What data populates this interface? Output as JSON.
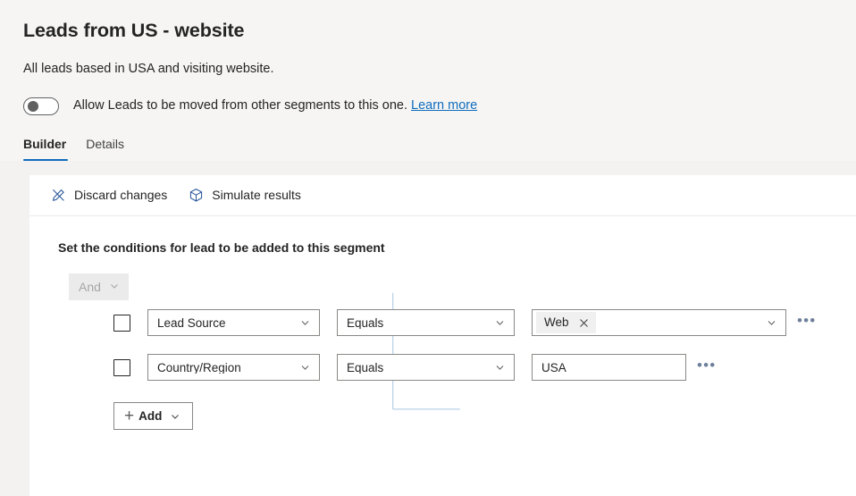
{
  "header": {
    "title": "Leads from US - website",
    "subtitle": "All leads based in USA and visiting website.",
    "toggle": {
      "state": "off",
      "label": "Allow Leads to be moved from other segments to this one.",
      "link_label": "Learn more"
    },
    "tabs": [
      {
        "label": "Builder",
        "active": true
      },
      {
        "label": "Details",
        "active": false
      }
    ]
  },
  "toolbar": {
    "discard_label": "Discard changes",
    "simulate_label": "Simulate results"
  },
  "builder": {
    "section_title": "Set the conditions for lead to be added to this segment",
    "group_operator": "And",
    "ellipsis_label": "•••",
    "rows": [
      {
        "checked": false,
        "attribute": "Lead Source",
        "operator": "Equals",
        "value_kind": "tag",
        "value": "Web",
        "tag_remove_label": "Remove Web"
      },
      {
        "checked": false,
        "attribute": "Country/Region",
        "operator": "Equals",
        "value_kind": "text",
        "value": "USA"
      }
    ],
    "add_label": "Add"
  },
  "colors": {
    "accent": "#0f6cbd",
    "tree_line": "#a9c5e0",
    "page_bg": "#f3f2f1",
    "panel_bg": "#ffffff",
    "field_border": "#8a8886"
  }
}
